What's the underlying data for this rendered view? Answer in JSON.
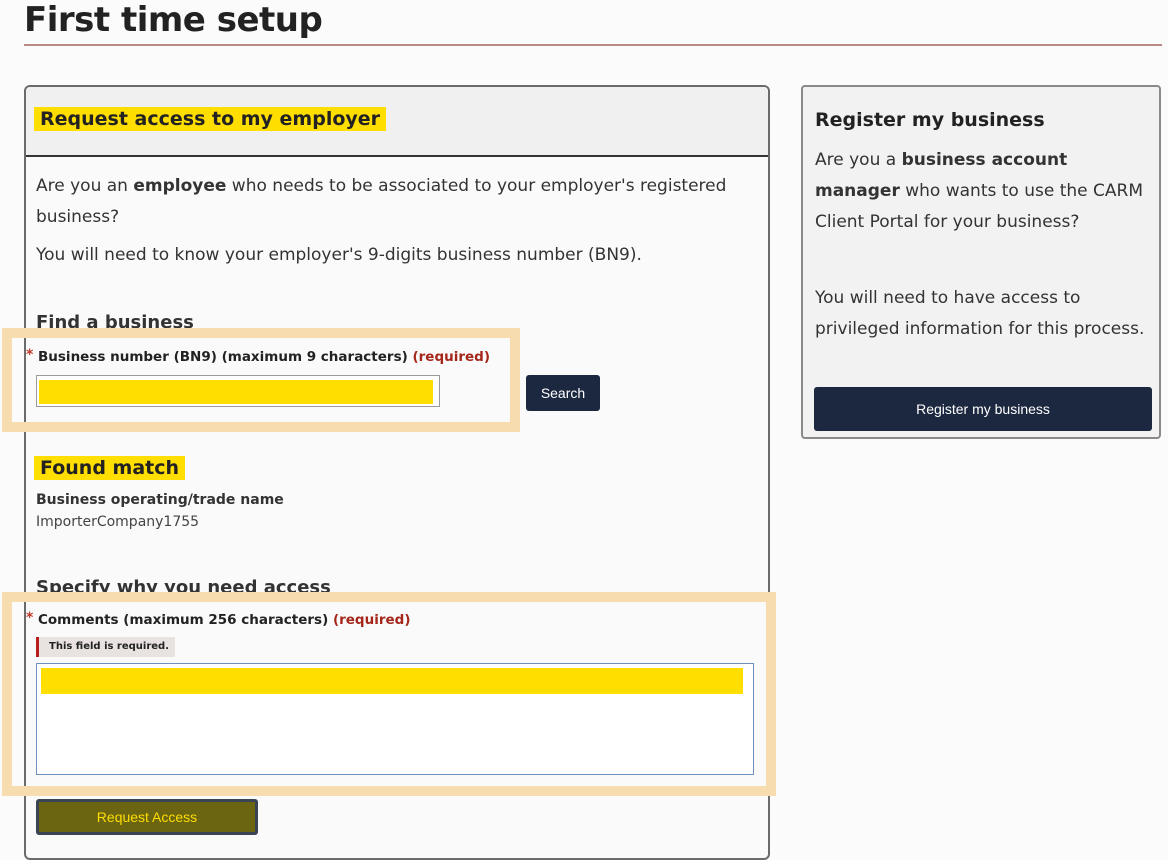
{
  "page": {
    "title": "First time setup"
  },
  "request_panel": {
    "title": "Request access to my employer",
    "intro_pre": "Are you an ",
    "intro_bold": "employee",
    "intro_post": " who needs to be associated to your employer's registered business?",
    "note": "You will need to know your employer's 9-digits business number (BN9).",
    "find_heading": "Find a business",
    "bn_label": "Business number (BN9) (maximum 9 characters) ",
    "bn_required": "(required)",
    "bn_value": "",
    "search_label": "Search",
    "found_title": "Found match",
    "trade_label": "Business operating/trade name",
    "trade_value": "ImporterCompany1755",
    "specify_heading": "Specify why you need access",
    "comments_label": "Comments (maximum 256 characters) ",
    "comments_required": "(required)",
    "error_message": "This field is required.",
    "comments_value": "",
    "request_button": "Request Access"
  },
  "register_panel": {
    "title": "Register my business",
    "q_pre": "Are you a ",
    "q_bold": "business account manager",
    "q_post": " who wants to use the CARM Client Portal for your business?",
    "note": "You will need to have access to privileged information for this process.",
    "button": "Register my business"
  },
  "colors": {
    "highlight": "#ffde00",
    "required": "#a5271b",
    "button_primary": "#1b2840",
    "annotation_box": "#f7dcb0"
  }
}
